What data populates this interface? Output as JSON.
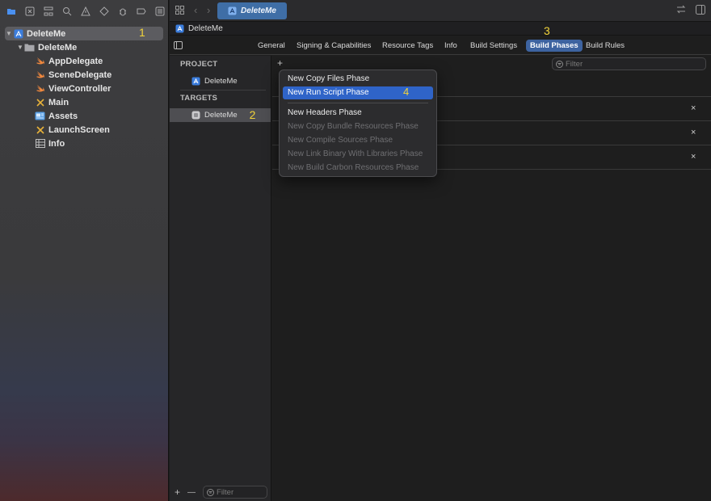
{
  "navigator": {
    "toolbar_icons": [
      "folder-icon",
      "source-control-icon",
      "hierarchy-icon",
      "find-icon",
      "issue-icon",
      "test-icon",
      "debug-icon",
      "breakpoint-icon",
      "report-icon"
    ],
    "tree": [
      {
        "label": "DeleteMe",
        "kind": "project",
        "annotation": "1"
      },
      {
        "label": "DeleteMe",
        "kind": "group"
      },
      {
        "label": "AppDelegate",
        "kind": "swift"
      },
      {
        "label": "SceneDelegate",
        "kind": "swift"
      },
      {
        "label": "ViewController",
        "kind": "swift"
      },
      {
        "label": "Main",
        "kind": "storyboard"
      },
      {
        "label": "Assets",
        "kind": "assets"
      },
      {
        "label": "LaunchScreen",
        "kind": "storyboard"
      },
      {
        "label": "Info",
        "kind": "plist"
      }
    ]
  },
  "tabbar": {
    "document_tab": "DeleteMe"
  },
  "jumpbar": {
    "project": "DeleteMe"
  },
  "settings_tabs": {
    "items": [
      "General",
      "Signing & Capabilities",
      "Resource Tags",
      "Info",
      "Build Settings",
      "Build Phases",
      "Build Rules"
    ],
    "active": "Build Phases",
    "annotation": "3"
  },
  "targets_pane": {
    "project_header": "PROJECT",
    "project_item": "DeleteMe",
    "targets_header": "TARGETS",
    "target_item": "DeleteMe",
    "annotation": "2",
    "filter_placeholder": "Filter",
    "add": "+",
    "remove": "—"
  },
  "phases": {
    "add": "+",
    "filter_placeholder": "Filter",
    "remove_symbol": "×"
  },
  "menu": {
    "items": [
      {
        "label": "New Copy Files Phase",
        "enabled": true
      },
      {
        "label": "New Run Script Phase",
        "enabled": true,
        "highlighted": true
      },
      {
        "label": "New Headers Phase",
        "enabled": true
      },
      {
        "label": "New Copy Bundle Resources Phase",
        "enabled": false
      },
      {
        "label": "New Compile Sources Phase",
        "enabled": false
      },
      {
        "label": "New Link Binary With Libraries Phase",
        "enabled": false
      },
      {
        "label": "New Build Carbon Resources Phase",
        "enabled": false
      }
    ],
    "annotation": "4"
  },
  "colors": {
    "accent": "#2f64c8",
    "annotation": "#f2d43a",
    "swift": "#f0883e"
  }
}
